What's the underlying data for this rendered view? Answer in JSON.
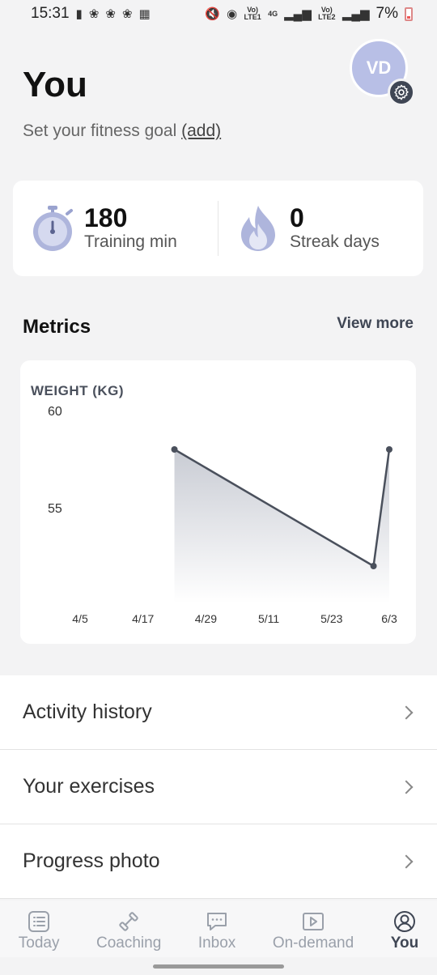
{
  "status_bar": {
    "time": "15:31",
    "network_1": "Vo) LTE1",
    "network_type": "4G",
    "network_2": "Vo) LTE2",
    "battery_percent": "7%"
  },
  "header": {
    "title": "You",
    "goal_prefix": "Set your fitness goal ",
    "goal_link": "(add)",
    "avatar_initials": "VD"
  },
  "stats": [
    {
      "value": "180",
      "label": "Training min",
      "icon": "stopwatch-icon"
    },
    {
      "value": "0",
      "label": "Streak days",
      "icon": "flame-icon"
    }
  ],
  "metrics": {
    "title": "Metrics",
    "view_more": "View more"
  },
  "chart_data": {
    "type": "area",
    "title": "WEIGHT (KG)",
    "y_ticks": [
      "60",
      "55"
    ],
    "x_ticks": [
      "4/5",
      "4/17",
      "4/29",
      "5/11",
      "5/23",
      "6/3"
    ],
    "ylim": [
      50,
      60
    ],
    "x_range": [
      "4/5",
      "6/3"
    ],
    "series": [
      {
        "points": [
          {
            "x": "4/23",
            "y": 58
          },
          {
            "x": "5/31",
            "y": 52
          },
          {
            "x": "6/3",
            "y": 58
          }
        ]
      }
    ],
    "line_color": "#4a505c"
  },
  "list": [
    {
      "label": "Activity history"
    },
    {
      "label": "Your exercises"
    },
    {
      "label": "Progress photo"
    }
  ],
  "bottom_nav": [
    {
      "label": "Today",
      "icon": "list-icon",
      "active": false
    },
    {
      "label": "Coaching",
      "icon": "dumbbell-icon",
      "active": false
    },
    {
      "label": "Inbox",
      "icon": "chat-icon",
      "active": false
    },
    {
      "label": "On-demand",
      "icon": "play-icon",
      "active": false
    },
    {
      "label": "You",
      "icon": "user-icon",
      "active": true
    }
  ]
}
